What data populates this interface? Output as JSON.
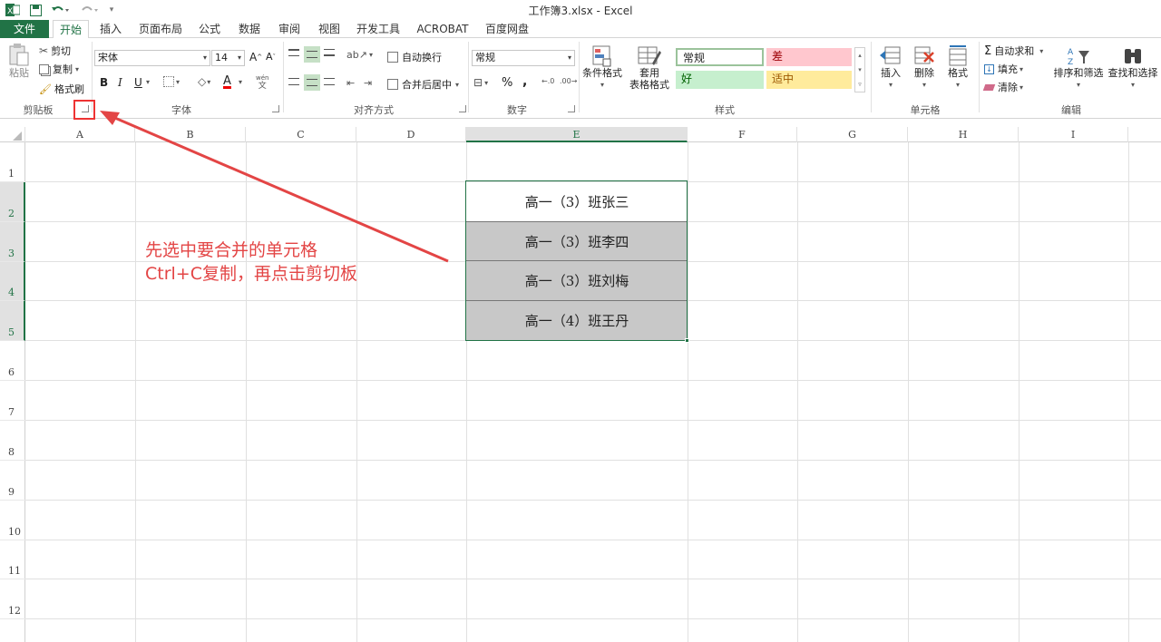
{
  "window": {
    "title": "工作簿3.xlsx - Excel"
  },
  "quick_access": {
    "redo_hint": "▾"
  },
  "tabs": [
    {
      "label": "文件"
    },
    {
      "label": "开始"
    },
    {
      "label": "插入"
    },
    {
      "label": "页面布局"
    },
    {
      "label": "公式"
    },
    {
      "label": "数据"
    },
    {
      "label": "审阅"
    },
    {
      "label": "视图"
    },
    {
      "label": "开发工具"
    },
    {
      "label": "ACROBAT"
    },
    {
      "label": "百度网盘"
    }
  ],
  "ribbon": {
    "clipboard": {
      "paste": "粘贴",
      "cut": "剪切",
      "copy": "复制",
      "format_painter": "格式刷",
      "label": "剪贴板"
    },
    "font": {
      "name": "宋体",
      "size": "14",
      "grow": "A",
      "shrink": "A",
      "bold": "B",
      "italic": "I",
      "underline": "U",
      "font_color": "A",
      "phonetic": "文",
      "label": "字体"
    },
    "alignment": {
      "wrap": "自动换行",
      "merge": "合并后居中",
      "label": "对齐方式"
    },
    "number": {
      "format": "常规",
      "percent": "%",
      "comma": ",",
      "label": "数字"
    },
    "styles": {
      "conditional": "条件格式",
      "table_top": "套用",
      "table_bottom": "表格格式",
      "normal": "常规",
      "bad": "差",
      "good": "好",
      "neutral": "适中",
      "label": "样式"
    },
    "cells": {
      "insert": "插入",
      "delete": "删除",
      "format": "格式",
      "label": "单元格"
    },
    "editing": {
      "autosum": "自动求和",
      "fill": "填充",
      "clear": "清除",
      "sort": "排序和筛选",
      "find": "查找和选择",
      "label": "编辑"
    }
  },
  "sheet": {
    "columns": [
      "A",
      "B",
      "C",
      "D",
      "E",
      "F",
      "G",
      "H",
      "I"
    ],
    "rows": [
      "1",
      "2",
      "3",
      "4",
      "5",
      "6",
      "7",
      "8",
      "9",
      "10",
      "11",
      "12"
    ],
    "cells": [
      {
        "ref": "E2",
        "text": "高一（3）班张三"
      },
      {
        "ref": "E3",
        "text": "高一（3）班李四"
      },
      {
        "ref": "E4",
        "text": "高一（3）班刘梅"
      },
      {
        "ref": "E5",
        "text": "高一（4）班王丹"
      }
    ]
  },
  "annotation": {
    "line1": "先选中要合并的单元格",
    "line2": "Ctrl+C复制，再点击剪切板"
  },
  "colors": {
    "excel_green": "#217346",
    "annotation_red": "#e34545",
    "selection_fill": "#c8c8c8"
  }
}
